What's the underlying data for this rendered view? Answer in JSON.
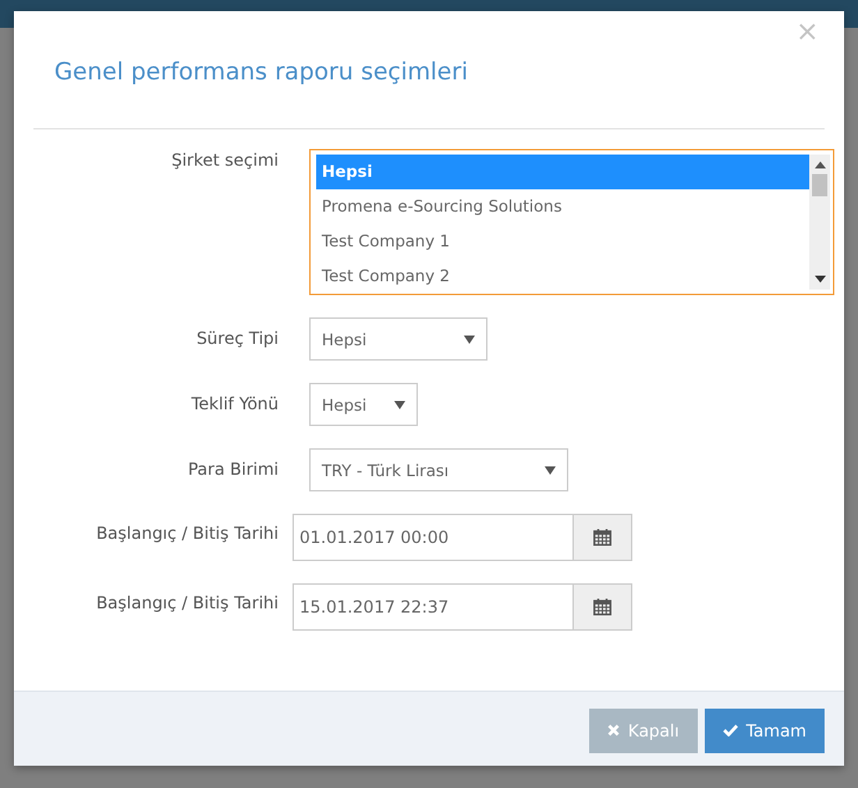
{
  "dialog": {
    "title": "Genel performans raporu seçimleri",
    "close_icon": "×"
  },
  "fields": [
    {
      "kind": "listbox",
      "label": "Şirket seçimi",
      "options": [
        {
          "label": "Hepsi",
          "selected": true
        },
        {
          "label": "Promena e-Sourcing Solutions",
          "selected": false
        },
        {
          "label": "Test Company 1",
          "selected": false
        },
        {
          "label": "Test Company 2",
          "selected": false
        }
      ]
    },
    {
      "kind": "select",
      "label": "Süreç Tipi",
      "value": "Hepsi"
    },
    {
      "kind": "select",
      "label": "Teklif Yönü",
      "value": "Hepsi"
    },
    {
      "kind": "select",
      "label": "Para Birimi",
      "value": "TRY - Türk Lirası"
    },
    {
      "kind": "date",
      "label": "Başlangıç / Bitiş Tarihi",
      "value": "01.01.2017 00:00"
    },
    {
      "kind": "date",
      "label": "Başlangıç / Bitiş Tarihi",
      "value": "15.01.2017 22:37"
    }
  ],
  "buttons": [
    {
      "kind": "close",
      "label": "Kapalı"
    },
    {
      "kind": "ok",
      "label": "Tamam"
    }
  ]
}
